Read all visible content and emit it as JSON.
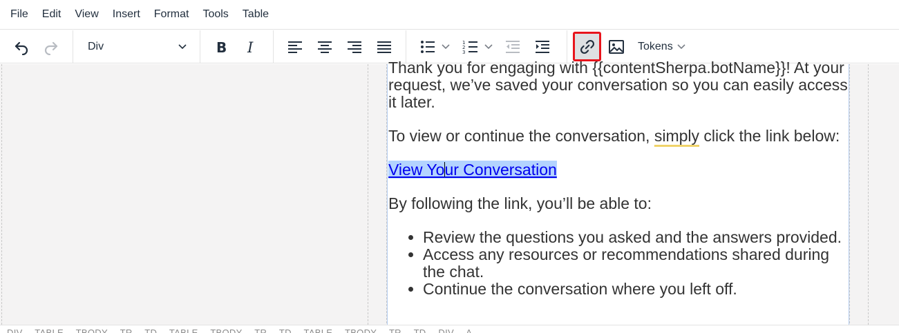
{
  "menubar": {
    "items": [
      "File",
      "Edit",
      "View",
      "Insert",
      "Format",
      "Tools",
      "Table"
    ]
  },
  "toolbar": {
    "block_format": "Div",
    "tokens_label": "Tokens",
    "icons": {
      "undo": "undo-icon",
      "redo": "redo-icon",
      "bold": "bold-icon",
      "italic": "italic-icon",
      "align_left": "align-left-icon",
      "align_center": "align-center-icon",
      "align_right": "align-right-icon",
      "justify": "justify-icon",
      "bullet_list": "bullet-list-icon",
      "numbered_list": "numbered-list-icon",
      "outdent": "outdent-icon",
      "indent": "indent-icon",
      "link": "link-icon",
      "image": "image-icon"
    },
    "highlight_color": "#e8141c"
  },
  "content": {
    "para1": "Thank you for engaging with {{contentSherpa.botName}}! At your request, we’ve saved your conversation so you can easily access it later.",
    "para2_before": "To view or continue the conversation, ",
    "para2_flagged": "simply",
    "para2_after": " click the link below:",
    "link_part1": "View Yo",
    "link_part2": "ur Conversation",
    "para3": "By following the link, you’ll be able to:",
    "bullets": [
      "Review the questions you asked and the answers provided.",
      "Access any resources or recommendations shared during the chat.",
      "Continue the conversation where you left off."
    ]
  },
  "statusbar": {
    "path": [
      "DIV",
      "TABLE",
      "TBODY",
      "TR",
      "TD",
      "TABLE",
      "TBODY",
      "TR",
      "TD",
      "TABLE",
      "TBODY",
      "TR",
      "TD",
      "DIV",
      "A"
    ]
  },
  "colors": {
    "selection": "#b3d3ff",
    "link": "#0000ee",
    "spellcheck_underline": "#f0d36a"
  }
}
